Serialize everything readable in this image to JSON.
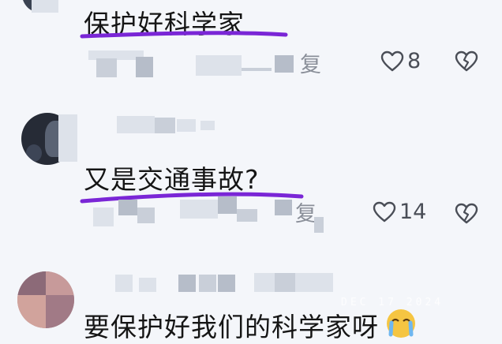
{
  "comments": [
    {
      "text": "保护好科学家",
      "reply_label": "复",
      "like_count": "8"
    },
    {
      "text": "又是交通事故?",
      "reply_label": "复",
      "like_count": "14"
    },
    {
      "text": "要保护好我们的科学家呀"
    }
  ],
  "watermark": "DEC 17 2024",
  "colors": {
    "underline": "#7a26d6",
    "icon": "#4a4e57"
  },
  "icons": {
    "like": "heart-outline-icon",
    "dislike": "broken-heart-icon",
    "emoji": "crying-face-emoji"
  }
}
